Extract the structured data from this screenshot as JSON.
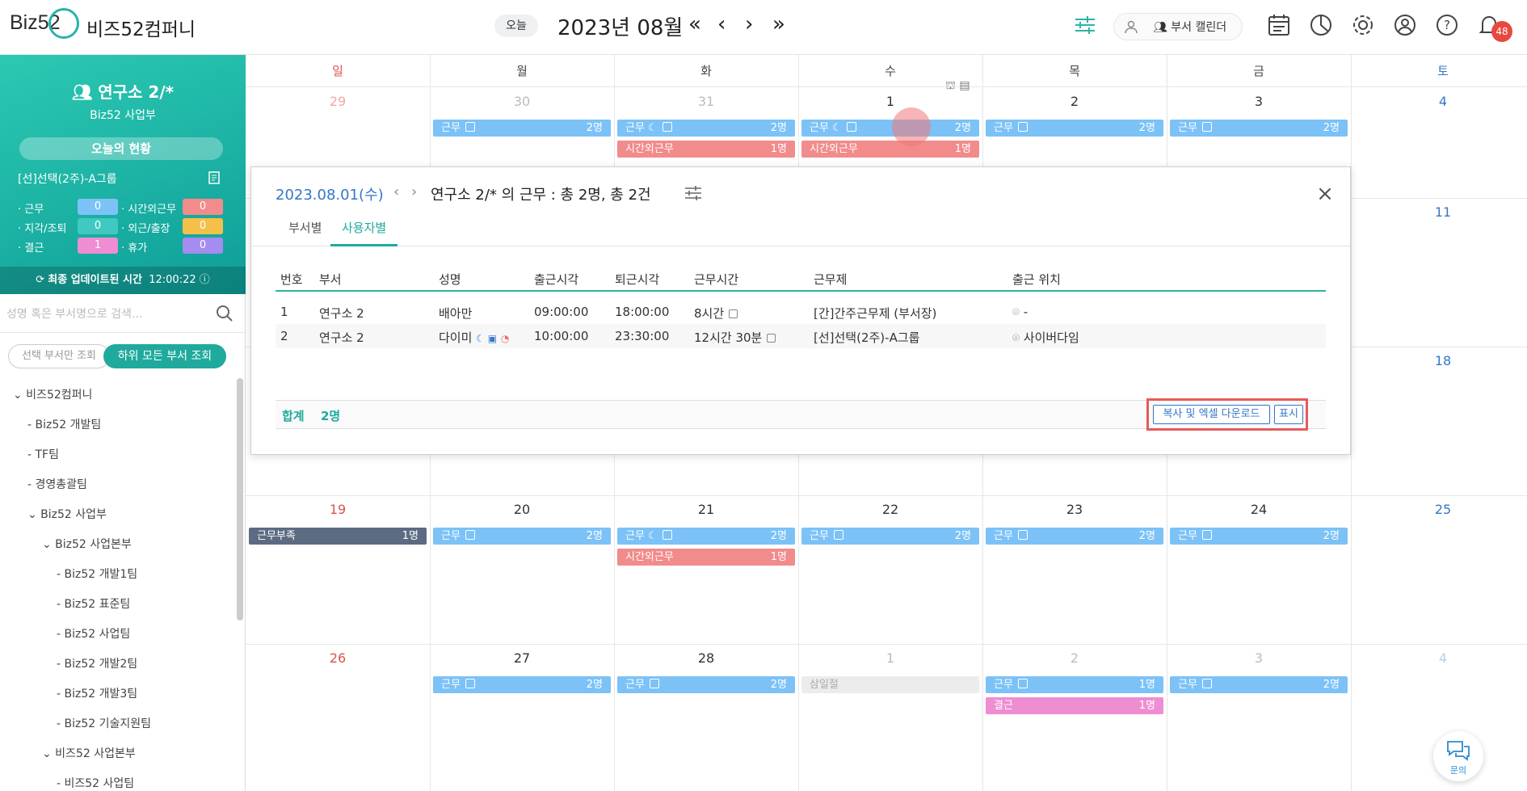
{
  "header": {
    "logo": "Biz52",
    "company": "비즈52컴퍼니",
    "today": "오늘",
    "month": "2023년 08월",
    "nav": {
      "first": "«",
      "prev": "‹",
      "next": "›",
      "last": "»"
    },
    "dept_calendar": "부서 캘린더",
    "notif_count": "48",
    "icons": [
      "filter-icon",
      "user-icon",
      "calendar-icon",
      "chart-icon",
      "gear-icon",
      "profile-icon",
      "help-icon",
      "bell-icon"
    ]
  },
  "sidebar": {
    "dept": "연구소 2/*",
    "dept_sub": "Biz52 사업부",
    "status_btn": "오늘의 현황",
    "schedule": "[선]선택(2주)-A그룹",
    "stats": [
      {
        "label": "· 근무",
        "value": "0",
        "color": "#7cc2f7"
      },
      {
        "label": "· 시간외근무",
        "value": "0",
        "color": "#f28b8b"
      },
      {
        "label": "· 지각/조퇴",
        "value": "0",
        "color": "#3fc9c0"
      },
      {
        "label": "· 외근/출장",
        "value": "0",
        "color": "#f5c04a"
      },
      {
        "label": "· 결근",
        "value": "1",
        "color": "#ef8dd2"
      },
      {
        "label": "· 휴가",
        "value": "0",
        "color": "#a48cf0"
      }
    ],
    "update_label": "최종 업데이트된 시간",
    "update_time": "12:00:22",
    "search_placeholder": "성명 혹은 부서명으로 검색...",
    "seg_selected": "선택 부서만 조회",
    "seg_all": "하위 모든 부서 조회",
    "tree": [
      {
        "label": "⌄ 비즈52컴퍼니",
        "indent": 0
      },
      {
        "label": "- Biz52 개발팀",
        "indent": 1
      },
      {
        "label": "- TF팀",
        "indent": 1
      },
      {
        "label": "- 경영총괄팀",
        "indent": 1
      },
      {
        "label": "⌄ Biz52 사업부",
        "indent": 1
      },
      {
        "label": "⌄ Biz52 사업본부",
        "indent": 2
      },
      {
        "label": "- Biz52 개발1팀",
        "indent": 3
      },
      {
        "label": "- Biz52 표준팀",
        "indent": 3
      },
      {
        "label": "- Biz52 사업팀",
        "indent": 3
      },
      {
        "label": "- Biz52 개발2팀",
        "indent": 3
      },
      {
        "label": "- Biz52 개발3팀",
        "indent": 3
      },
      {
        "label": "- Biz52 기술지원팀",
        "indent": 3
      },
      {
        "label": "⌄ 비즈52 사업본부",
        "indent": 2
      },
      {
        "label": "- 비즈52 사업팀",
        "indent": 3
      }
    ]
  },
  "calendar": {
    "weekdays": [
      {
        "label": "일",
        "color": "#d9534f"
      },
      {
        "label": "월",
        "color": "#444"
      },
      {
        "label": "화",
        "color": "#444"
      },
      {
        "label": "수",
        "color": "#444"
      },
      {
        "label": "목",
        "color": "#444"
      },
      {
        "label": "금",
        "color": "#444"
      },
      {
        "label": "토",
        "color": "#3577c7"
      }
    ],
    "weeks": [
      {
        "days": [
          {
            "num": "29",
            "dim": true
          },
          {
            "num": "30",
            "dim": true
          },
          {
            "num": "31",
            "dim": true
          },
          {
            "num": "1"
          },
          {
            "num": "2"
          },
          {
            "num": "3"
          },
          {
            "num": "4"
          }
        ],
        "events": [
          {
            "col": 1,
            "row": 0,
            "label": "근무",
            "count": "2명",
            "kind": "blue"
          },
          {
            "col": 2,
            "row": 0,
            "label": "근무",
            "count": "2명",
            "kind": "blue",
            "moon": true
          },
          {
            "col": 2,
            "row": 1,
            "label": "시간외근무",
            "count": "1명",
            "kind": "pink"
          },
          {
            "col": 3,
            "row": 0,
            "label": "근무",
            "count": "2명",
            "kind": "blue",
            "moon": true
          },
          {
            "col": 3,
            "row": 1,
            "label": "시간외근무",
            "count": "1명",
            "kind": "pink"
          },
          {
            "col": 4,
            "row": 0,
            "label": "근무",
            "count": "2명",
            "kind": "blue"
          },
          {
            "col": 5,
            "row": 0,
            "label": "근무",
            "count": "2명",
            "kind": "blue"
          }
        ]
      },
      {
        "days": [
          {
            "num": ""
          },
          {
            "num": ""
          },
          {
            "num": ""
          },
          {
            "num": ""
          },
          {
            "num": ""
          },
          {
            "num": ""
          },
          {
            "num": "11"
          }
        ],
        "events": []
      },
      {
        "days": [
          {
            "num": ""
          },
          {
            "num": ""
          },
          {
            "num": ""
          },
          {
            "num": ""
          },
          {
            "num": ""
          },
          {
            "num": ""
          },
          {
            "num": "18"
          }
        ],
        "events": []
      },
      {
        "days": [
          {
            "num": "19"
          },
          {
            "num": "20"
          },
          {
            "num": "21"
          },
          {
            "num": "22"
          },
          {
            "num": "23"
          },
          {
            "num": "24"
          },
          {
            "num": "25"
          }
        ],
        "events": [
          {
            "col": 0,
            "row": 0,
            "label": "근무부족",
            "count": "1명",
            "kind": "slate"
          },
          {
            "col": 1,
            "row": 0,
            "label": "근무",
            "count": "2명",
            "kind": "blue"
          },
          {
            "col": 2,
            "row": 0,
            "label": "근무",
            "count": "2명",
            "kind": "blue",
            "moon": true
          },
          {
            "col": 2,
            "row": 1,
            "label": "시간외근무",
            "count": "1명",
            "kind": "pink"
          },
          {
            "col": 3,
            "row": 0,
            "label": "근무",
            "count": "2명",
            "kind": "blue"
          },
          {
            "col": 4,
            "row": 0,
            "label": "근무",
            "count": "2명",
            "kind": "blue"
          },
          {
            "col": 5,
            "row": 0,
            "label": "근무",
            "count": "2명",
            "kind": "blue"
          }
        ]
      },
      {
        "days": [
          {
            "num": "26"
          },
          {
            "num": "27"
          },
          {
            "num": "28"
          },
          {
            "num": "1",
            "dim": true
          },
          {
            "num": "2",
            "dim": true
          },
          {
            "num": "3",
            "dim": true
          },
          {
            "num": "4",
            "dim": true
          }
        ],
        "events": [
          {
            "col": 1,
            "row": 0,
            "label": "근무",
            "count": "2명",
            "kind": "blue"
          },
          {
            "col": 2,
            "row": 0,
            "label": "근무",
            "count": "2명",
            "kind": "blue"
          },
          {
            "col": 3,
            "row": 0,
            "label": "삼일절",
            "count": "",
            "kind": "gray"
          },
          {
            "col": 4,
            "row": 0,
            "label": "근무",
            "count": "1명",
            "kind": "blue"
          },
          {
            "col": 4,
            "row": 1,
            "label": "결근",
            "count": "1명",
            "kind": "mag"
          },
          {
            "col": 5,
            "row": 0,
            "label": "근무",
            "count": "2명",
            "kind": "blue"
          }
        ]
      }
    ]
  },
  "modal": {
    "date": "2023.08.01(수)",
    "title": "연구소 2/* 의 근무 : 총 2명, 총 2건",
    "tabs": [
      "부서별",
      "사용자별"
    ],
    "columns": [
      "번호",
      "부서",
      "성명",
      "출근시각",
      "퇴근시각",
      "근무시간",
      "근무제",
      "출근 위치"
    ],
    "rows": [
      {
        "no": "1",
        "dept": "연구소 2",
        "name": "배아만",
        "in": "09:00:00",
        "out": "18:00:00",
        "hours": "8시간",
        "system": "[간]간주근무제 (부서장)",
        "loc": "-"
      },
      {
        "no": "2",
        "dept": "연구소 2",
        "name": "다이미",
        "in": "10:00:00",
        "out": "23:30:00",
        "hours": "12시간 30분",
        "system": "[선]선택(2주)-A그룹",
        "loc": "사이버다임"
      }
    ],
    "sum_label": "합계",
    "sum_count": "2명",
    "btn_download": "복사 및 엑셀 다운로드",
    "btn_show": "표시"
  },
  "chat": {
    "label": "문의"
  }
}
